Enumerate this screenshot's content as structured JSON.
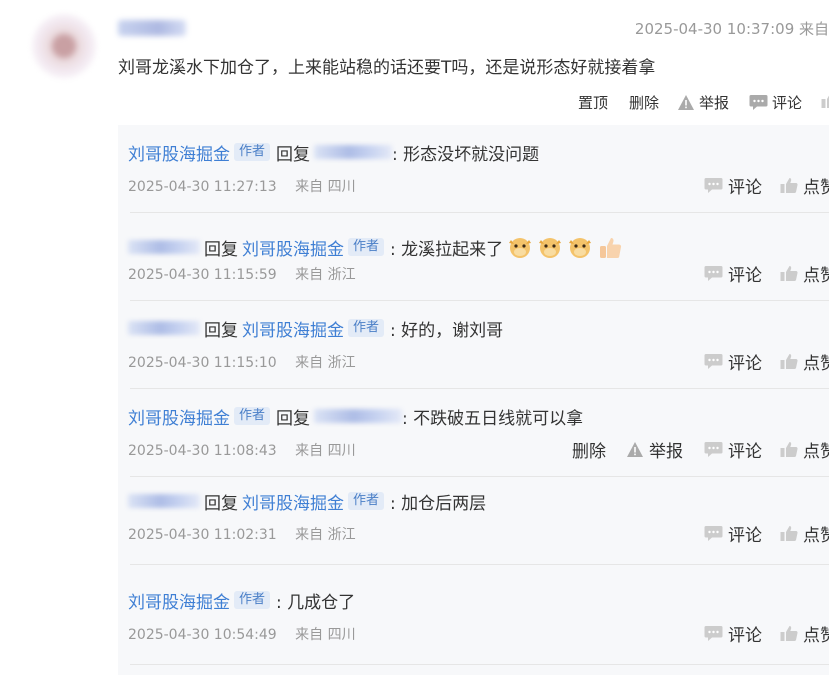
{
  "main_comment": {
    "timestamp": "2025-04-30 10:37:09 来自",
    "text": "刘哥龙溪水下加仓了，上来能站稳的话还要T吗，还是说形态好就接着拿",
    "actions": {
      "pin": "置顶",
      "delete": "删除",
      "report": "举报",
      "comment": "评论"
    }
  },
  "labels": {
    "reply_to": "回复",
    "author_tag": "作者",
    "from": "来自",
    "comment": "评论",
    "like": "点赞",
    "delete": "删除",
    "report": "举报"
  },
  "replies": [
    {
      "author": "刘哥股海掘金",
      "reply_to_user": "",
      "text": ": 形态没坏就没问题",
      "time": "2025-04-30 11:27:13",
      "location": "四川"
    },
    {
      "author": "",
      "reply_to_user": "刘哥股海掘金",
      "text": ": 龙溪拉起来了",
      "time": "2025-04-30 11:15:59",
      "location": "浙江"
    },
    {
      "author": "",
      "reply_to_user": "刘哥股海掘金",
      "text": ": 好的，谢刘哥",
      "time": "2025-04-30 11:15:10",
      "location": "浙江"
    },
    {
      "author": "刘哥股海掘金",
      "reply_to_user": "",
      "text": ": 不跌破五日线就可以拿",
      "time": "2025-04-30 11:08:43",
      "location": "四川"
    },
    {
      "author": "",
      "reply_to_user": "刘哥股海掘金",
      "text": ": 加仓后两层",
      "time": "2025-04-30 11:02:31",
      "location": "浙江"
    },
    {
      "author": "刘哥股海掘金",
      "reply_to_user": "",
      "text": ": 几成仓了",
      "time": "2025-04-30 10:54:49",
      "location": "四川"
    }
  ],
  "icons": {
    "report": "warning-triangle-icon",
    "comment": "speech-bubble-icon",
    "like": "thumbs-up-icon",
    "emoji_cow": "cow-face-emoji",
    "emoji_thumb": "thumbs-up-emoji"
  },
  "colors": {
    "link": "#3f7fd4",
    "tag_bg": "#e3ebf7",
    "panel_bg": "#f7f8fa",
    "meta_text": "#999999"
  }
}
